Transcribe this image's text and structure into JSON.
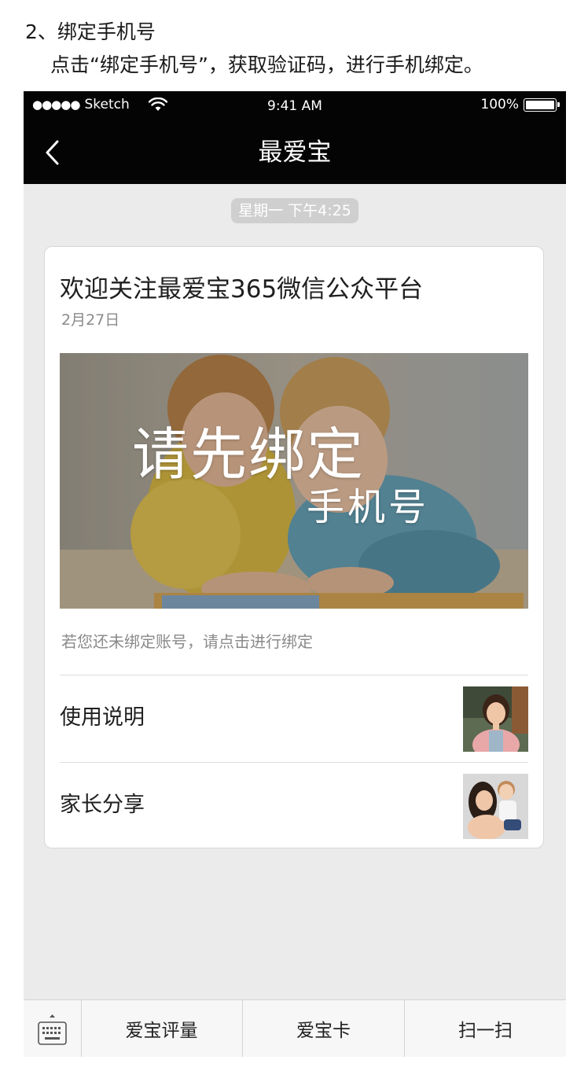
{
  "doc": {
    "step": "2、绑定手机号",
    "description": "点击“绑定手机号”，获取验证码，进行手机绑定。"
  },
  "statusbar": {
    "signal": "●●●●●",
    "carrier": "Sketch",
    "time": "9:41 AM",
    "battery": "100%",
    "battery_level": 1.0
  },
  "navbar": {
    "title": "最爱宝",
    "back_icon": "chevron-left-icon"
  },
  "chat": {
    "timestamp": "星期一 下午4:25"
  },
  "card": {
    "title": "欢迎关注最爱宝365微信公众平台",
    "date": "2月27日",
    "hero_line1": "请先绑定",
    "hero_line2": "手机号",
    "description": "若您还未绑定账号，请点击进行绑定",
    "items": [
      {
        "label": "使用说明",
        "thumb": "teacher-photo"
      },
      {
        "label": "家长分享",
        "thumb": "mother-child-photo"
      }
    ]
  },
  "bottom_menu": {
    "keyboard_icon": "keyboard-icon",
    "items": [
      {
        "label": "爱宝评量"
      },
      {
        "label": "爱宝卡"
      },
      {
        "label": "扫一扫"
      }
    ]
  },
  "colors": {
    "bar_bg": "#050404",
    "chat_bg": "#ebebeb",
    "timestamp_bg": "#cfcfcf"
  }
}
